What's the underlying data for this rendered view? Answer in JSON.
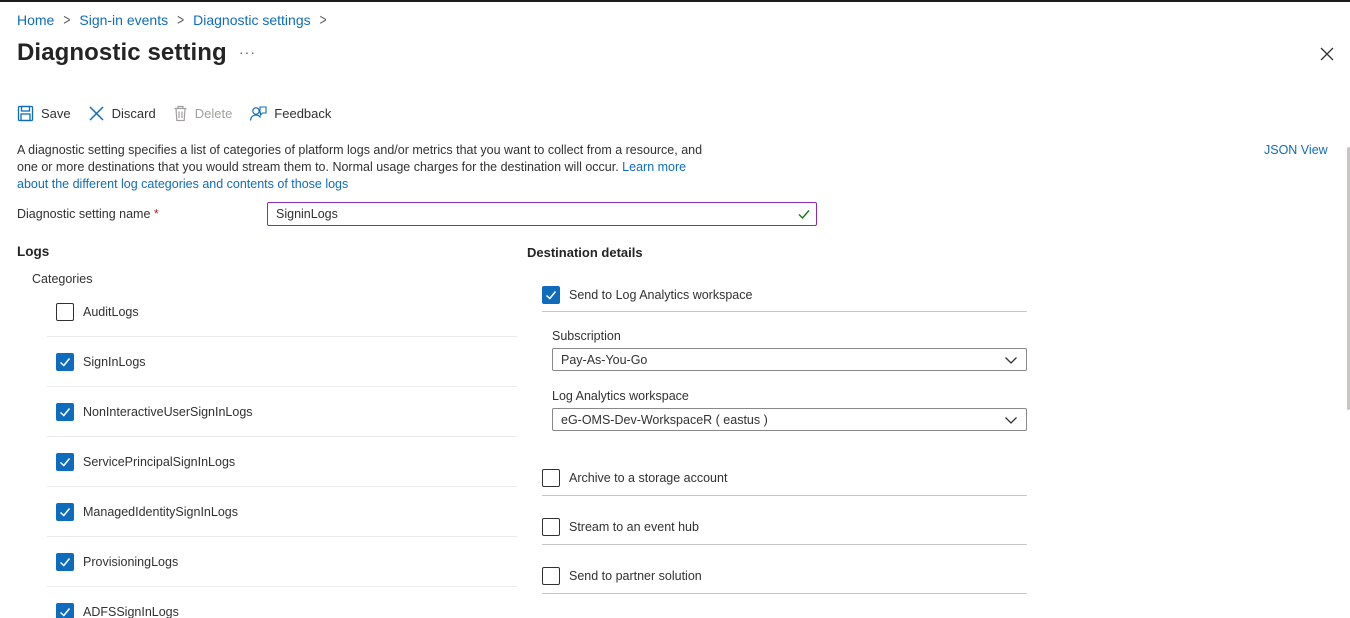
{
  "breadcrumb": [
    "Home",
    "Sign-in events",
    "Diagnostic settings"
  ],
  "header": {
    "title": "Diagnostic setting",
    "more": "···"
  },
  "toolbar": {
    "save": "Save",
    "discard": "Discard",
    "delete": "Delete",
    "feedback": "Feedback"
  },
  "description": {
    "text": "A diagnostic setting specifies a list of categories of platform logs and/or metrics that you want to collect from a resource, and one or more destinations that you would stream them to. Normal usage charges for the destination will occur. ",
    "link": "Learn more about the different log categories and contents of those logs"
  },
  "json_view": "JSON View",
  "setting_name": {
    "label": "Diagnostic setting name",
    "required": "*",
    "value": "SigninLogs"
  },
  "logs": {
    "heading": "Logs",
    "categories_heading": "Categories",
    "items": [
      {
        "label": "AuditLogs",
        "checked": false
      },
      {
        "label": "SignInLogs",
        "checked": true
      },
      {
        "label": "NonInteractiveUserSignInLogs",
        "checked": true
      },
      {
        "label": "ServicePrincipalSignInLogs",
        "checked": true
      },
      {
        "label": "ManagedIdentitySignInLogs",
        "checked": true
      },
      {
        "label": "ProvisioningLogs",
        "checked": true
      },
      {
        "label": "ADFSSignInLogs",
        "checked": true
      }
    ]
  },
  "destination": {
    "heading": "Destination details",
    "log_analytics": {
      "label": "Send to Log Analytics workspace",
      "checked": true
    },
    "subscription": {
      "label": "Subscription",
      "value": "Pay-As-You-Go"
    },
    "workspace": {
      "label": "Log Analytics workspace",
      "value": "eG-OMS-Dev-WorkspaceR ( eastus )"
    },
    "archive": {
      "label": "Archive to a storage account",
      "checked": false
    },
    "event_hub": {
      "label": "Stream to an event hub",
      "checked": false
    },
    "partner": {
      "label": "Send to partner solution",
      "checked": false
    }
  },
  "colors": {
    "accent": "#0f6cbd",
    "input_focus": "#8a2bb1",
    "valid": "#107c10"
  }
}
